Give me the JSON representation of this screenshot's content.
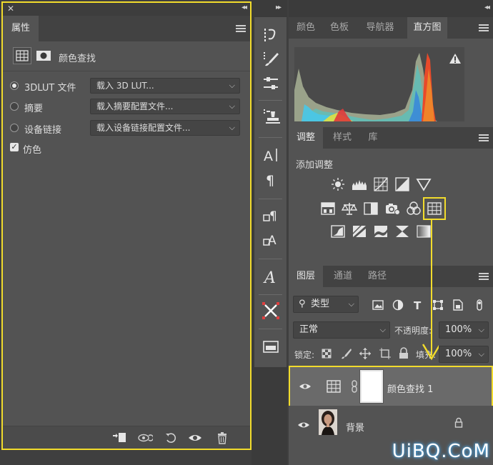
{
  "properties_panel": {
    "tab_label": "属性",
    "adjustment_title": "颜色查找",
    "options": [
      {
        "label": "3DLUT 文件",
        "selected": true,
        "dropdown": "载入 3D LUT..."
      },
      {
        "label": "摘要",
        "selected": false,
        "dropdown": "载入摘要配置文件..."
      },
      {
        "label": "设备链接",
        "selected": false,
        "dropdown": "载入设备链接配置文件..."
      }
    ],
    "dither_label": "仿色",
    "dither_checked": true
  },
  "histogram_panel": {
    "tabs": [
      "颜色",
      "色板",
      "导航器",
      "直方图"
    ],
    "active_tab": "直方图"
  },
  "adjustments_panel": {
    "tabs": [
      "调整",
      "样式",
      "库"
    ],
    "active_tab": "调整",
    "add_label": "添加调整"
  },
  "layers_panel": {
    "tabs": [
      "图层",
      "通道",
      "路径"
    ],
    "active_tab": "图层",
    "filter_kind": "类型",
    "blend_mode": "正常",
    "opacity_label": "不透明度:",
    "opacity_value": "100%",
    "lock_label": "锁定:",
    "fill_label": "填充:",
    "fill_value": "100%",
    "layers": [
      {
        "name": "颜色查找 1",
        "selected": true
      },
      {
        "name": "背景",
        "selected": false,
        "locked": true
      }
    ]
  },
  "watermark": "UiBQ.CoM",
  "colors": {
    "highlight": "#f2dc2c",
    "panel_bg": "#535353",
    "tab_bg": "#424242"
  }
}
